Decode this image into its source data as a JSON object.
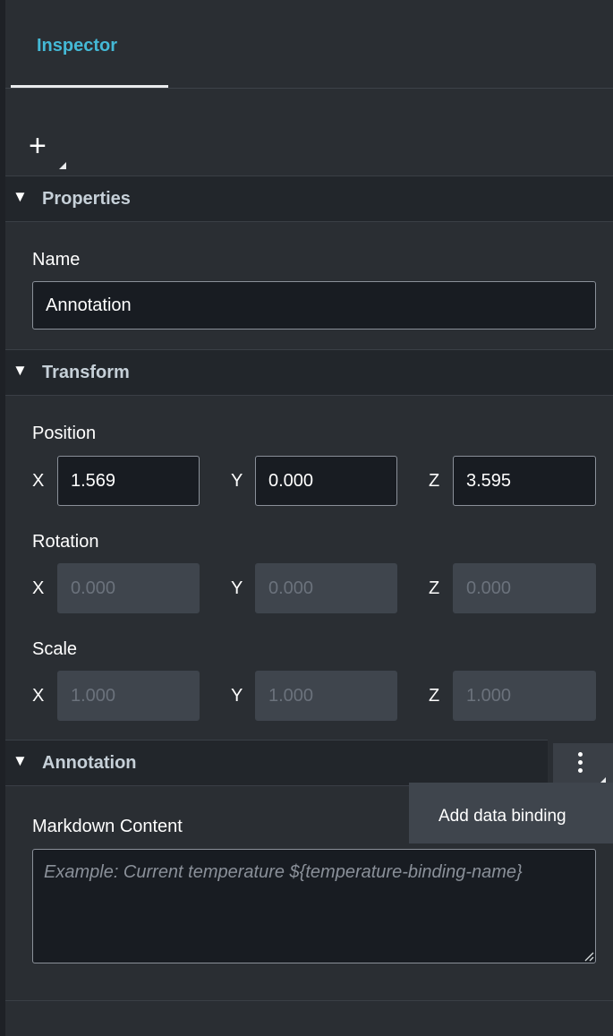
{
  "tabs": [
    {
      "label": "Inspector",
      "active": true
    }
  ],
  "toolbar": {
    "add_icon": "plus-icon"
  },
  "sections": {
    "properties": {
      "title": "Properties",
      "name_label": "Name",
      "name_value": "Annotation"
    },
    "transform": {
      "title": "Transform",
      "position": {
        "label": "Position",
        "x": "1.569",
        "y": "0.000",
        "z": "3.595"
      },
      "rotation": {
        "label": "Rotation",
        "x": "0.000",
        "y": "0.000",
        "z": "0.000"
      },
      "scale": {
        "label": "Scale",
        "x": "1.000",
        "y": "1.000",
        "z": "1.000"
      },
      "axes": {
        "x": "X",
        "y": "Y",
        "z": "Z"
      }
    },
    "annotation": {
      "title": "Annotation",
      "menu_icon": "more-vertical-icon",
      "menu_items": [
        "Add data binding"
      ],
      "markdown_label": "Markdown Content",
      "markdown_placeholder": "Example: Current temperature ${temperature-binding-name}"
    }
  },
  "colors": {
    "accent": "#44b9d6",
    "panel_bg": "#2a2e33",
    "section_header_bg": "#22262b",
    "input_bg": "#181c22",
    "disabled_input_bg": "#3f454d"
  }
}
